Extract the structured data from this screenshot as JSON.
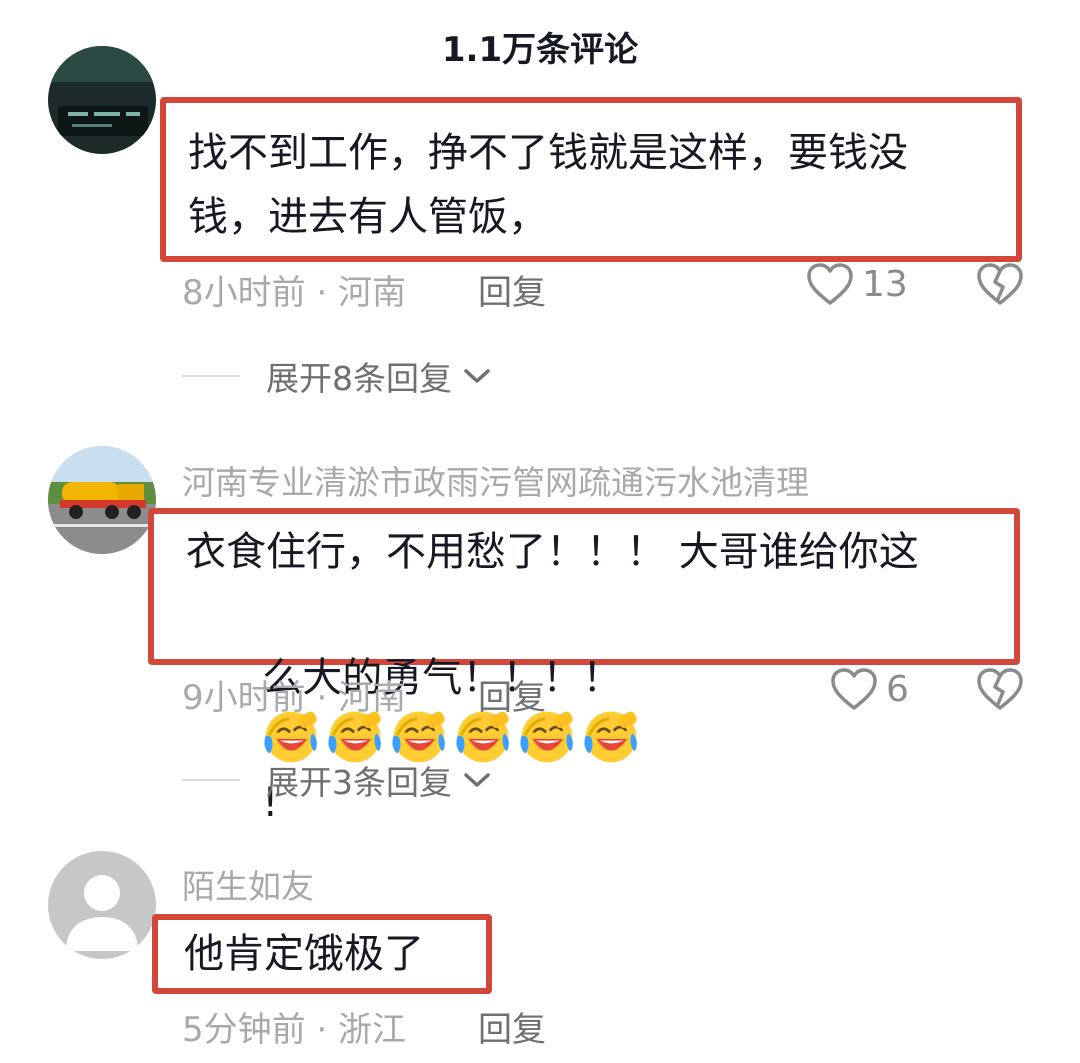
{
  "header": {
    "title": "1.1万条评论"
  },
  "comments": [
    {
      "content_line1": "找不到工作，挣不了钱就是这样，要钱没",
      "content_line2": "钱，进去有人管饭，",
      "time_location": "8小时前 · 河南",
      "reply_label": "回复",
      "likes": "13",
      "expand_label": "展开8条回复"
    },
    {
      "username": "河南专业清淤市政雨污管网疏通污水池清理",
      "content_line1": "衣食住行，不用愁了！！！ 大哥谁给你这",
      "content_line2_text": "么大的勇气！！！！ ",
      "content_line2_tail": "!",
      "emoji_name": "laugh-cry-emoji",
      "time_location": "9小时前 · 河南",
      "reply_label": "回复",
      "likes": "6",
      "expand_label": "展开3条回复"
    },
    {
      "username": "陌生如友",
      "content_line1": "他肯定饿极了",
      "time_location": "5分钟前 · 浙江",
      "reply_label": "回复"
    }
  ],
  "colors": {
    "highlight_border": "#d3463a",
    "meta_text": "#a8a9ad",
    "primary_text": "#161823"
  }
}
